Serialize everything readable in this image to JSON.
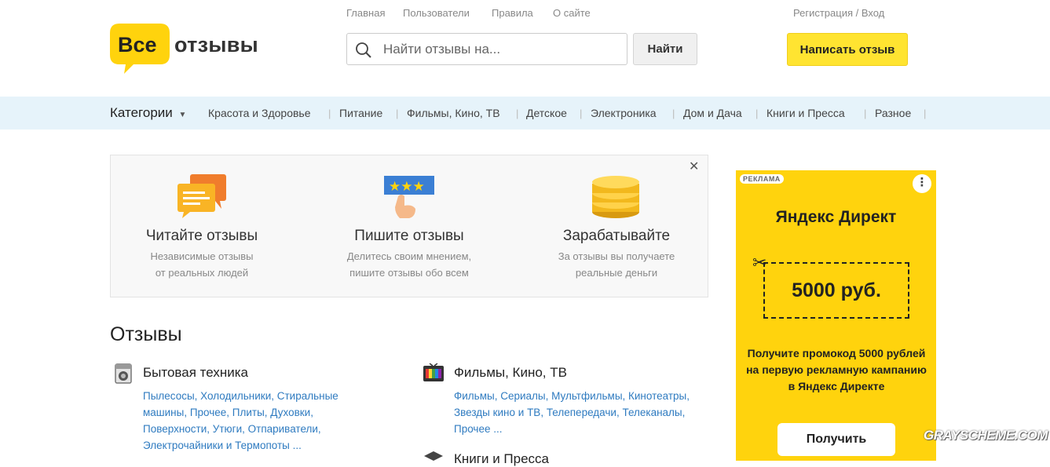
{
  "logo": {
    "word1": "Все",
    "word2": "отзывы"
  },
  "topnav": [
    "Главная",
    "Пользователи",
    "Правила",
    "О сайте"
  ],
  "auth": "Регистрация / Вход",
  "search": {
    "placeholder": "Найти отзывы на...",
    "button": "Найти"
  },
  "write_button": "Написать отзыв",
  "categories": {
    "label": "Категории",
    "items": [
      "Красота и Здоровье",
      "Питание",
      "Фильмы, Кино, ТВ",
      "Детское",
      "Электроника",
      "Дом и Дача",
      "Книги и Пресса",
      "Разное"
    ]
  },
  "promo": [
    {
      "title": "Читайте отзывы",
      "line1": "Независимые отзывы",
      "line2": "от реальных людей"
    },
    {
      "title": "Пишите отзывы",
      "line1": "Делитесь своим мнением,",
      "line2": "пишите отзывы обо всем"
    },
    {
      "title": "Зарабатывайте",
      "line1": "За отзывы вы получаете",
      "line2": "реальные деньги"
    }
  ],
  "reviews": {
    "title": "Отзывы",
    "categories": [
      {
        "title": "Бытовая техника",
        "links": "Пылесосы, Холодильники, Стиральные машины, Прочее, Плиты, Духовки, Поверхности, Утюги, Отпариватели, Электрочайники и Термопоты ..."
      },
      {
        "title": "Фильмы, Кино, ТВ",
        "links": "Фильмы, Сериалы, Мультфильмы, Кинотеатры, Звезды кино и ТВ, Телепередачи, Телеканалы, Прочее ..."
      },
      {
        "title": "Книги и Пресса"
      }
    ]
  },
  "ad": {
    "tag": "РЕКЛАМА",
    "brand": "Яндекс Директ",
    "coupon": "5000 руб.",
    "desc": "Получите промокод 5000 рублей на первую рекламную кампанию в Яндекс Директе",
    "button": "Получить"
  },
  "watermark": "GRAYSCHEME.COM",
  "colors": {
    "accent_yellow": "#ffe431",
    "ad_yellow": "#ffd30d",
    "catbar": "#e6f3fa",
    "link": "#2f7bc0"
  }
}
